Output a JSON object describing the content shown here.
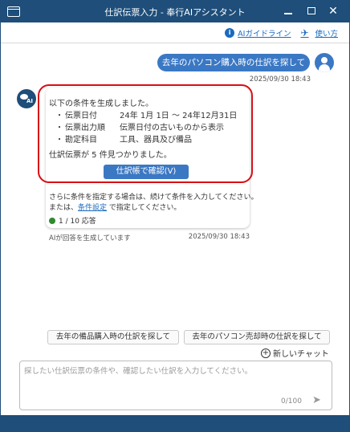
{
  "window": {
    "title": "仕訳伝票入力 - 奉行AIアシスタント",
    "controls": {
      "minimize": "minimize-icon",
      "maximize": "maximize-icon",
      "close": "✕"
    }
  },
  "toplinks": {
    "guide_label": "AIガイドライン",
    "guide_icon": "info-icon",
    "howto_label": "使い方",
    "howto_icon": "bird-icon"
  },
  "chat": {
    "user_message": "去年のパソコン購入時の仕訳を探して",
    "user_timestamp": "2025/09/30 18:43",
    "ai_avatar_text": "AI",
    "ai": {
      "heading": "以下の条件を生成しました。",
      "conditions": [
        {
          "bullet": "・",
          "label": "伝票日付",
          "value": "24年 1月 1日 ～ 24年12月31日"
        },
        {
          "bullet": "・",
          "label": "伝票出力順",
          "value": "伝票日付の古いものから表示"
        },
        {
          "bullet": "・",
          "label": "勘定科目",
          "value": "工具、器具及び備品"
        }
      ],
      "found_text": "仕訳伝票が 5 件見つかりました。",
      "confirm_button": "仕訳帳で確認(V)",
      "more_line1": "さらに条件を指定する場合は、続けて条件を入力してください。",
      "more_line2_prefix": "または、",
      "more_link": "条件設定",
      "more_line2_suffix": " で指定してください。",
      "count_text": "1 / 10 応答",
      "status_text": "AIが回答を生成しています",
      "timestamp": "2025/09/30 18:43"
    }
  },
  "suggestions": [
    "去年の備品購入時の仕訳を探して",
    "去年のパソコン売却時の仕訳を探して"
  ],
  "new_chat_label": "新しいチャット",
  "input": {
    "placeholder": "探したい仕訳伝票の条件や、確認したい仕訳を入力してください。",
    "counter": "0/100"
  },
  "colors": {
    "titlebar": "#1e4e79",
    "accent": "#3b78c4",
    "highlight": "#d90d16",
    "link": "#1a6bbf",
    "status_dot": "#2e8b2e"
  }
}
